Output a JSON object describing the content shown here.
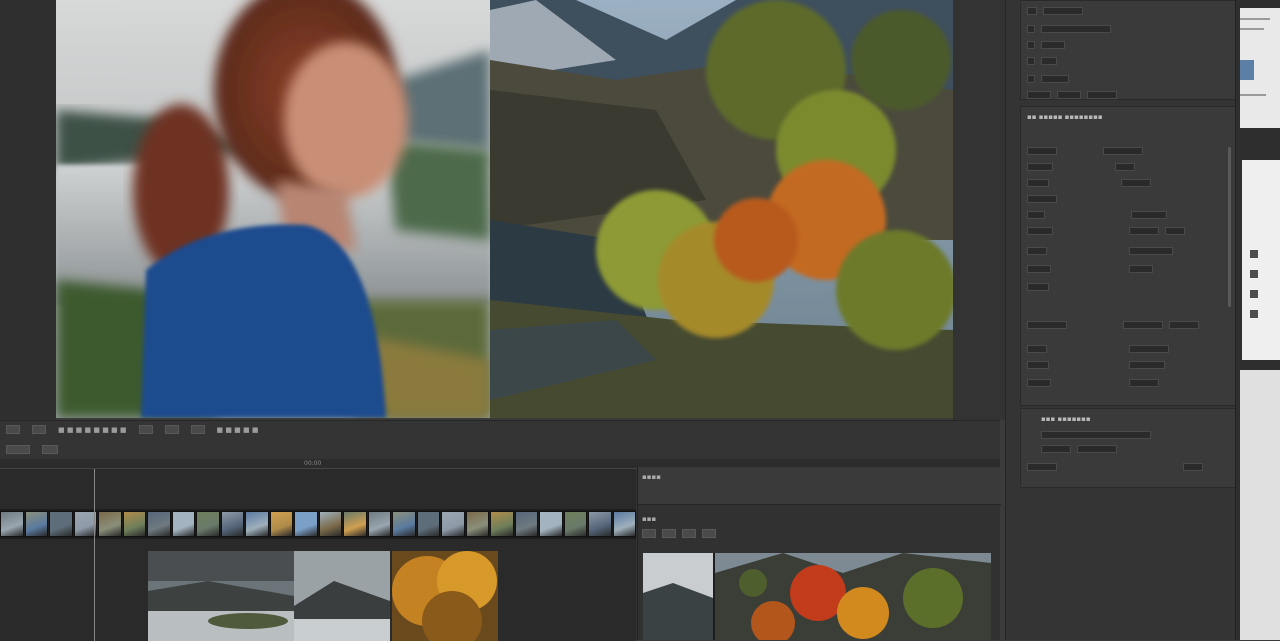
{
  "timeline": {
    "toolbar": [
      "■ ■ ■ ■ ■ ■ ■ ■",
      "■ ■ ■ ■ ■"
    ],
    "ruler_marker": "00:00"
  },
  "preview": {
    "tab_label": "▪▪▪▪",
    "tab_label_2": "▪▪▪"
  },
  "inspector": {
    "section_1_title": "▪▪▪ ▪▪▪▪▪",
    "section_2_title": "▪▪ ▪▪▪▪▪ ▪▪▪▪▪▪▪▪",
    "section_3_title": "▪▪▪ ▪▪▪▪▪▪▪"
  },
  "colors": {
    "panel_bg": "#3a3a3a",
    "app_bg": "#343434",
    "accent": "#4a7fd0"
  },
  "icons": [
    "chevron-icon",
    "gear-icon",
    "play-icon",
    "lock-icon"
  ]
}
